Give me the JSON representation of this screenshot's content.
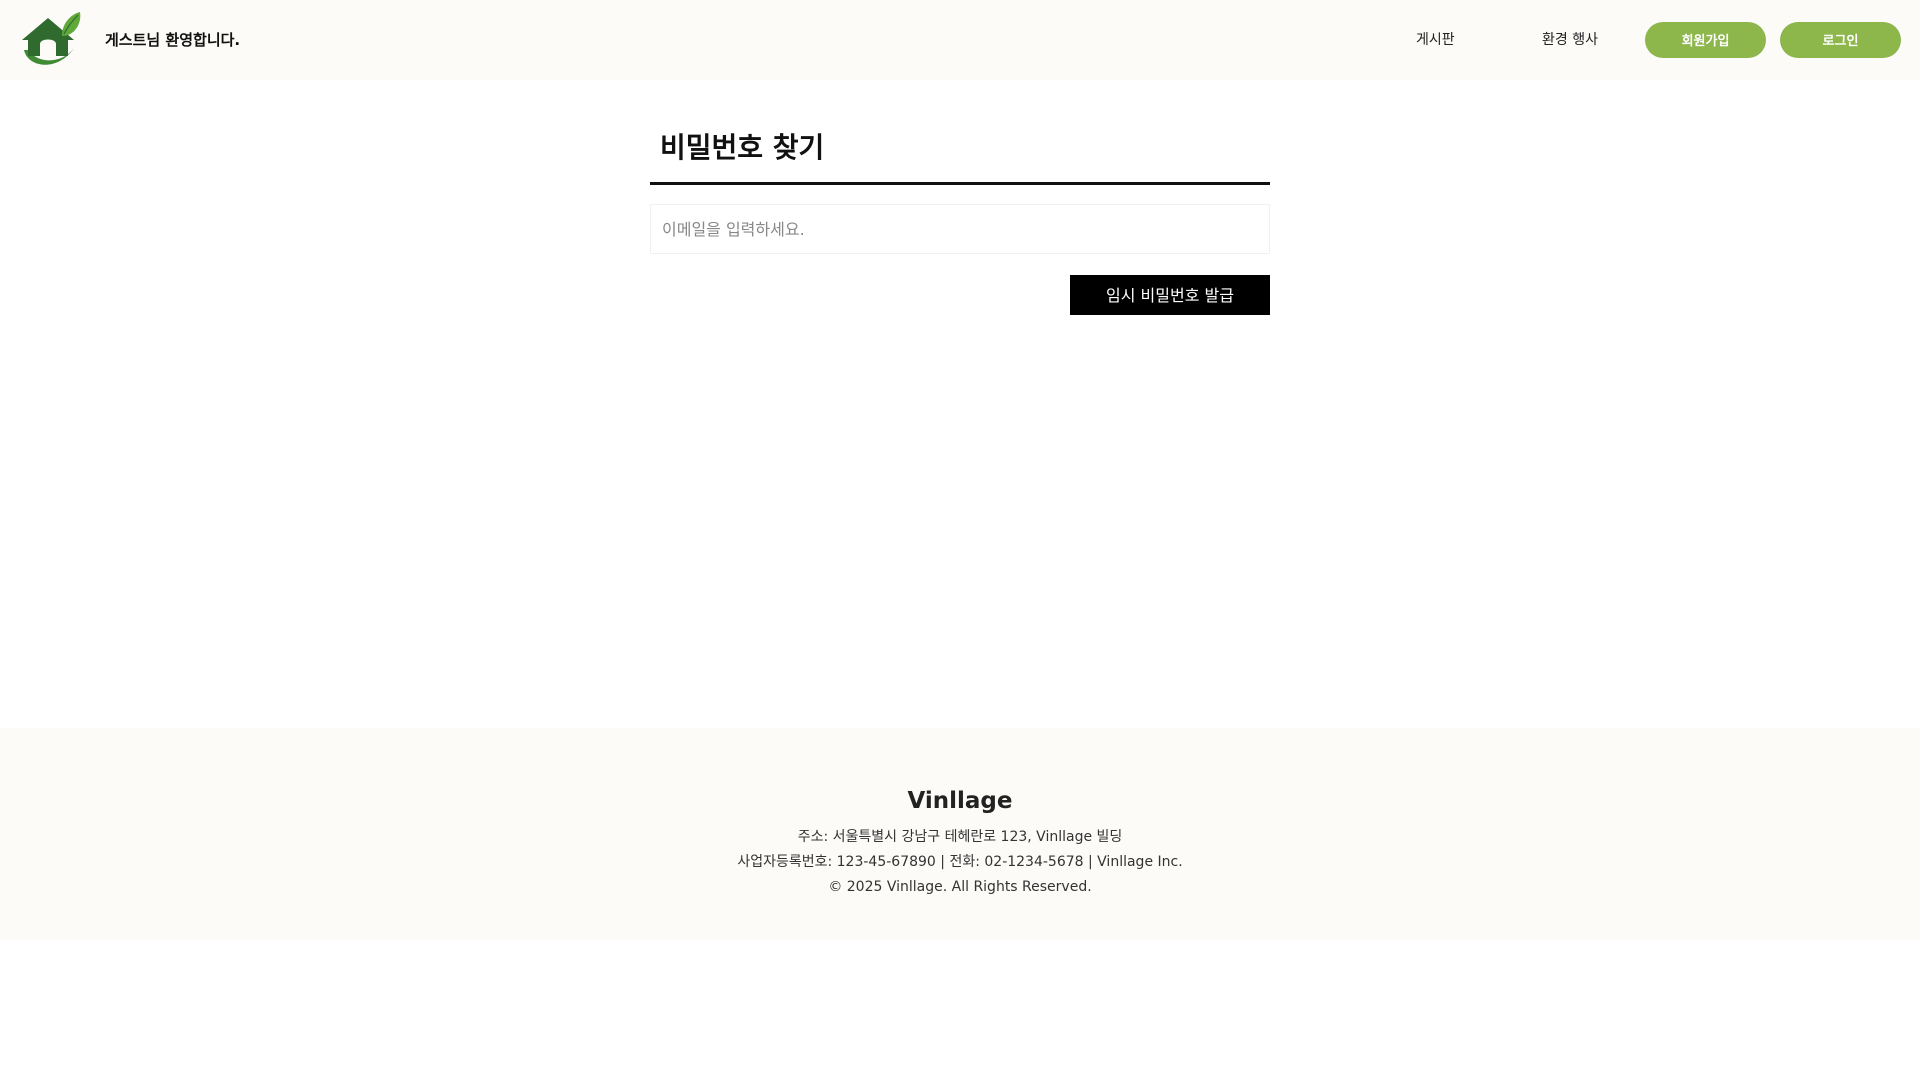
{
  "header": {
    "welcome_text": "게스트님 환영합니다.",
    "nav": {
      "board": "게시판",
      "events": "환경 행사"
    },
    "buttons": {
      "signup": "회원가입",
      "login": "로그인"
    },
    "logo_icon": "house-leaf-logo-icon"
  },
  "main": {
    "title": "비밀번호 찾기",
    "email_placeholder": "이메일을 입력하세요.",
    "submit_label": "임시 비밀번호 발급"
  },
  "footer": {
    "brand": "Vinllage",
    "address": "주소: 서울특별시 강남구 테헤란로 123, Vinllage 빌딩",
    "business_info": "사업자등록번호: 123-45-67890 | 전화: 02-1234-5678 | Vinllage Inc.",
    "copyright": "© 2025 Vinllage. All Rights Reserved."
  },
  "colors": {
    "header_bg": "#fcfbf8",
    "accent_green": "#8db64b",
    "logo_dark_green": "#2f6b2f",
    "logo_leaf_green": "#5fa83a",
    "button_black": "#000000",
    "footer_bg": "#fcfbf8"
  }
}
